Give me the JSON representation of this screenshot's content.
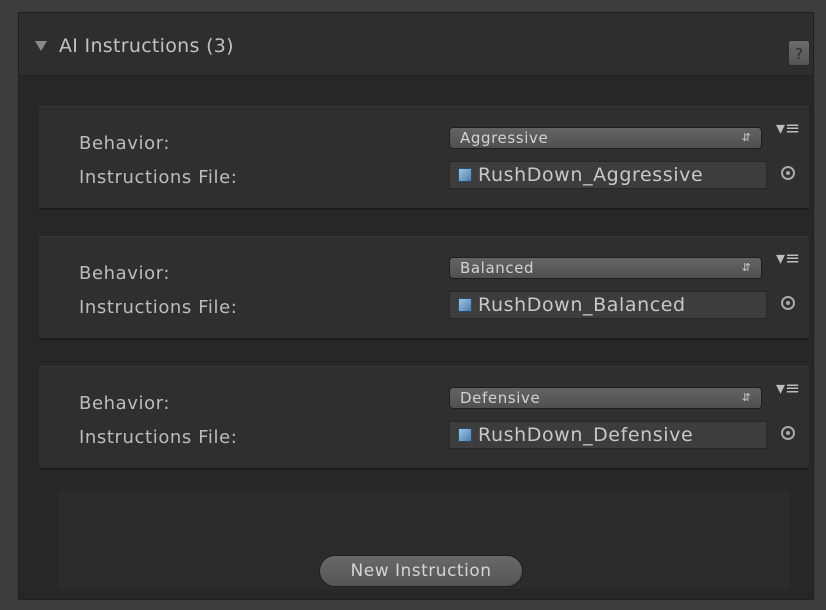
{
  "header": {
    "title": "AI Instructions (3)",
    "help_label": "?"
  },
  "instructions": [
    {
      "behavior_label": "Behavior:",
      "behavior_value": "Aggressive",
      "file_label": "Instructions File:",
      "file_value": "RushDown_Aggressive"
    },
    {
      "behavior_label": "Behavior:",
      "behavior_value": "Balanced",
      "file_label": "Instructions File:",
      "file_value": "RushDown_Balanced"
    },
    {
      "behavior_label": "Behavior:",
      "behavior_value": "Defensive",
      "file_label": "Instructions File:",
      "file_value": "RushDown_Defensive"
    }
  ],
  "footer": {
    "new_button_label": "New Instruction"
  },
  "icons": {
    "foldout": "triangle-down-icon",
    "help": "help-icon",
    "dropdown_arrows": "updown-arrows-icon",
    "options": "context-menu-icon",
    "file": "asset-file-icon",
    "picker": "object-picker-icon"
  },
  "colors": {
    "panel_bg": "#2a2a2a",
    "section_bg": "#2f2f2f",
    "text": "#bdbdbd"
  }
}
